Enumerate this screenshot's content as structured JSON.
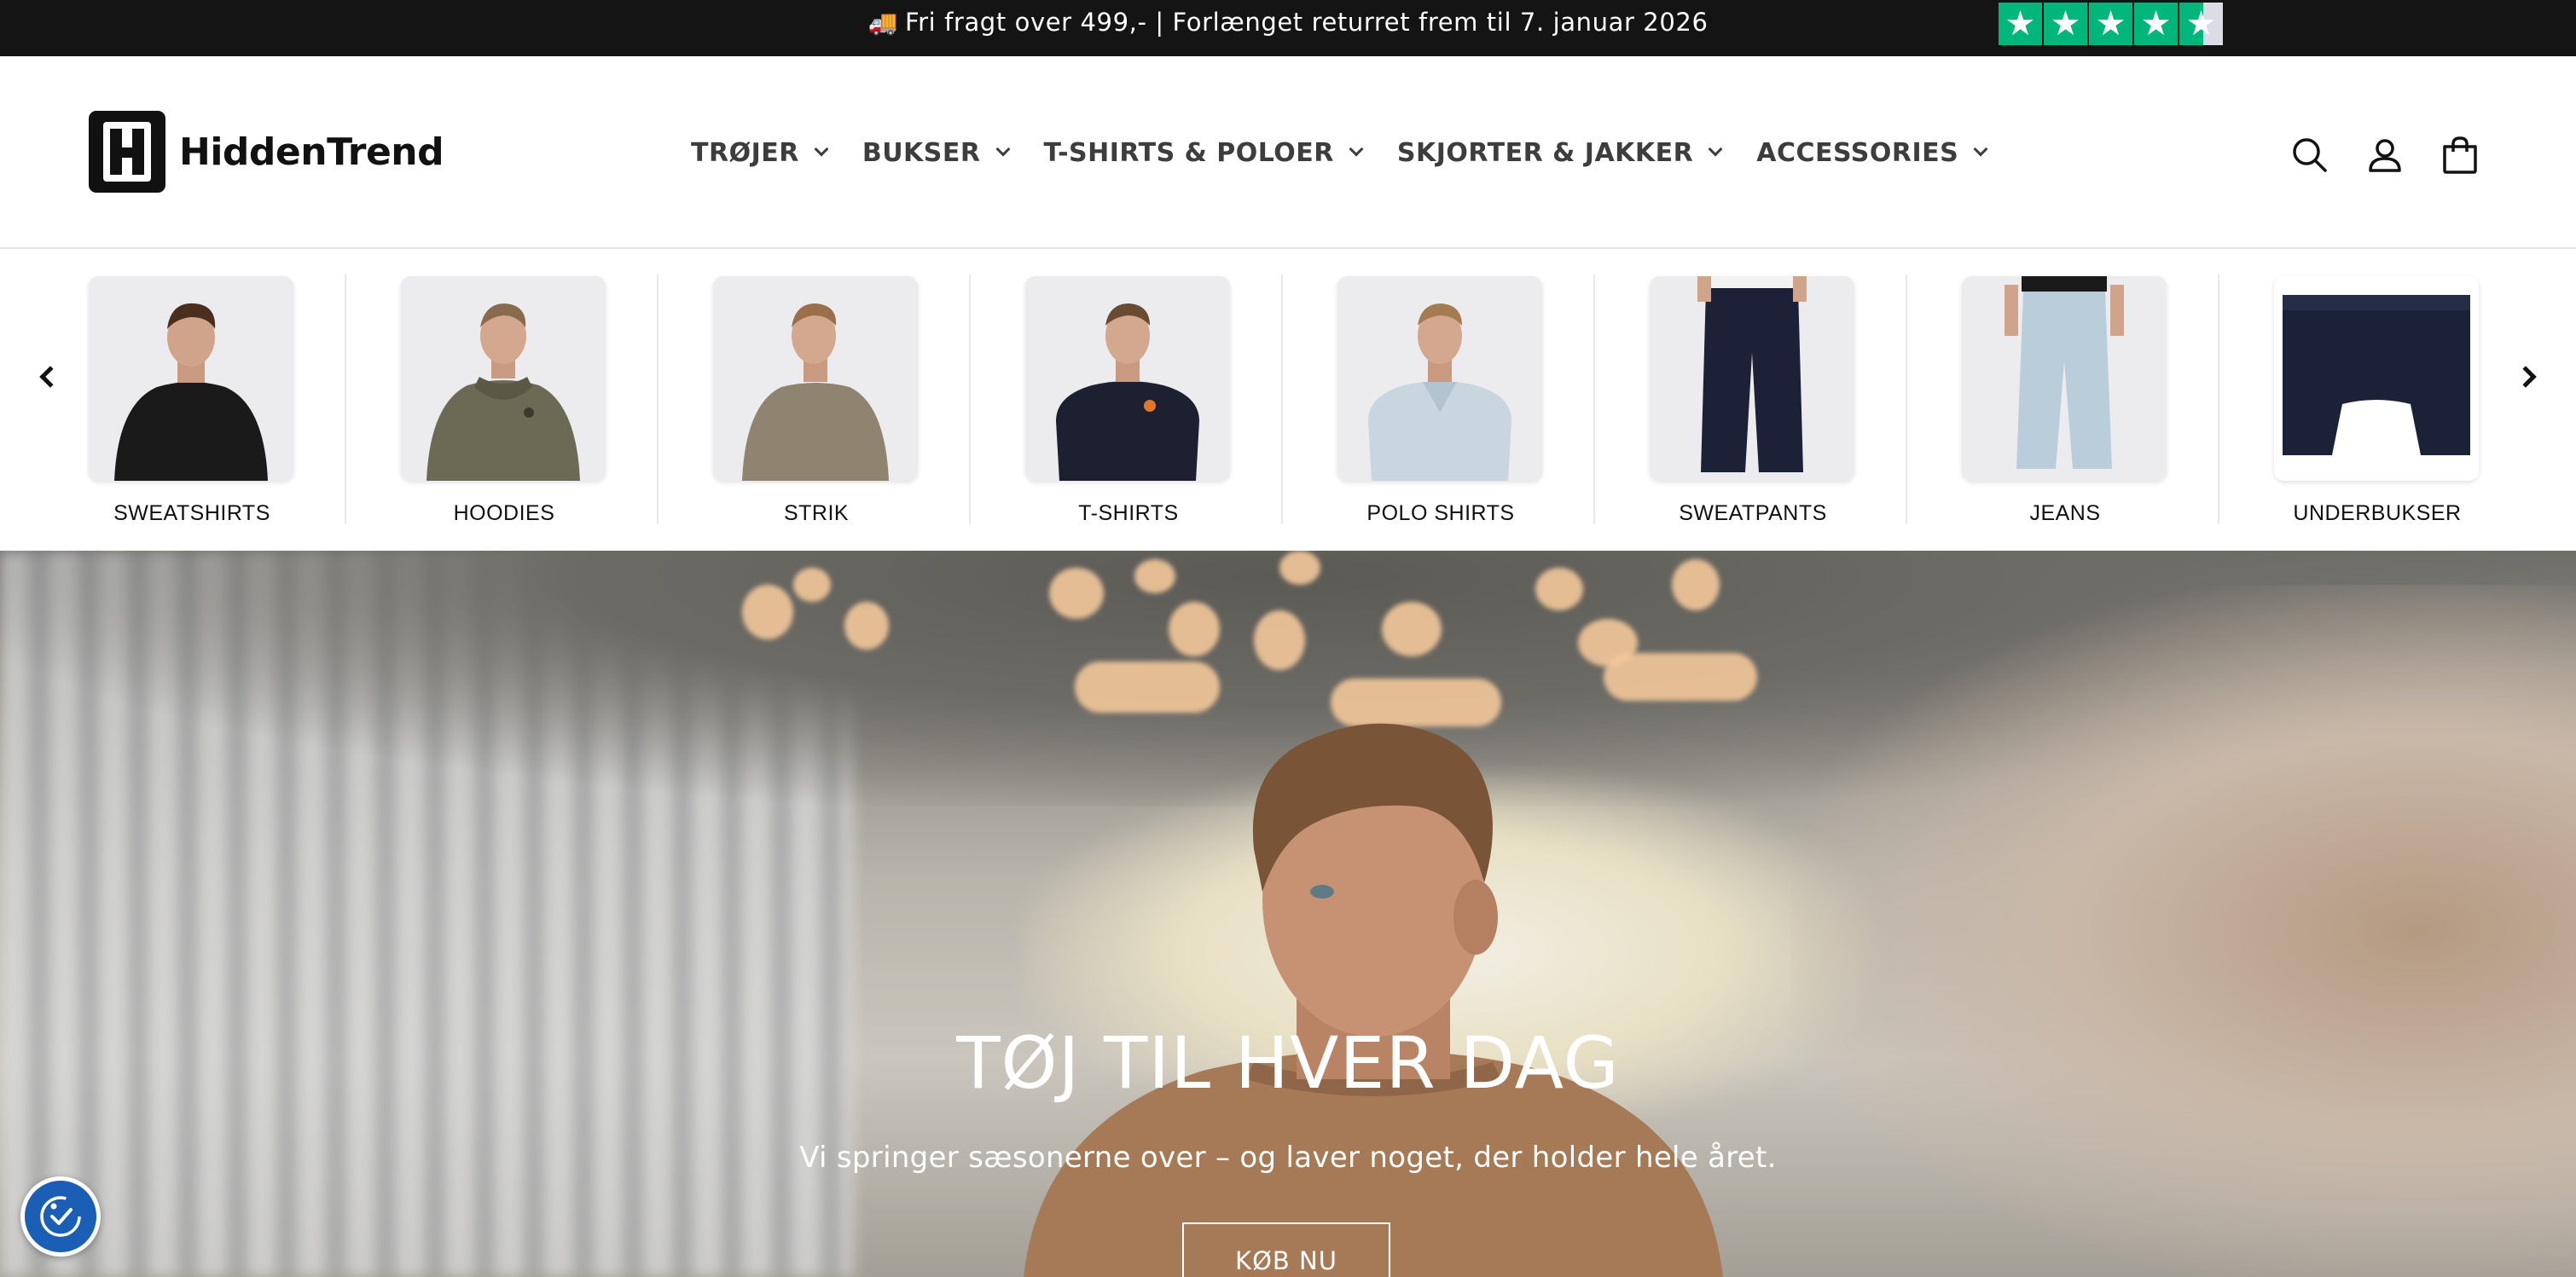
{
  "announcement": {
    "icon": "truck-icon",
    "text": "Fri fragt over 499,- | Forlænget returret frem til 7. januar 2026",
    "rating_stars": 4.5,
    "rating_color": "#00b67a"
  },
  "header": {
    "logo_text": "HiddenTrend",
    "nav": [
      {
        "label": "TRØJER"
      },
      {
        "label": "BUKSER"
      },
      {
        "label": "T-SHIRTS & POLOER"
      },
      {
        "label": "SKJORTER & JAKKER"
      },
      {
        "label": "ACCESSORIES"
      }
    ],
    "icons": [
      "search-icon",
      "account-icon",
      "cart-icon"
    ]
  },
  "categories": [
    {
      "label": "SWEATSHIRTS"
    },
    {
      "label": "HOODIES"
    },
    {
      "label": "STRIK"
    },
    {
      "label": "T-SHIRTS"
    },
    {
      "label": "POLO SHIRTS"
    },
    {
      "label": "SWEATPANTS"
    },
    {
      "label": "JEANS"
    },
    {
      "label": "UNDERBUKSER"
    }
  ],
  "hero": {
    "title": "TØJ TIL HVER DAG",
    "subtitle": "Vi springer sæsonerne over – og laver noget, der holder hele året.",
    "button": "KØB NU"
  },
  "colors": {
    "announcement_bg": "#141414",
    "accessibility_badge": "#1a5eb5"
  }
}
